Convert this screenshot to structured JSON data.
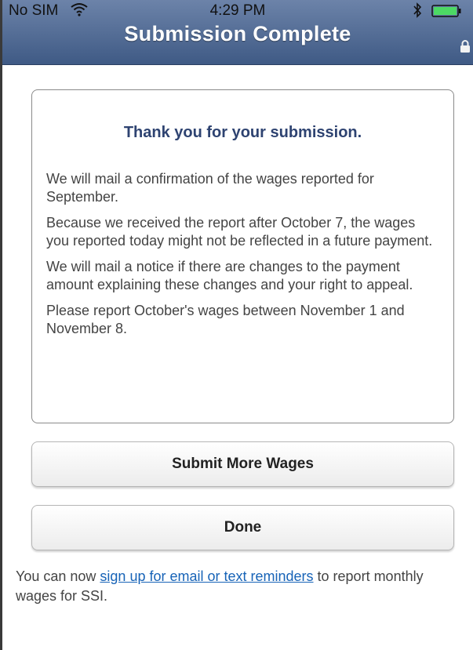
{
  "status_bar": {
    "carrier": "No SIM",
    "time": "4:29 PM",
    "wifi_icon": "wifi-icon",
    "bluetooth_icon": "bluetooth-icon",
    "battery_icon": "battery-icon"
  },
  "header": {
    "title": "Submission Complete",
    "lock_icon": "lock-icon",
    "color": "#4a648f"
  },
  "card": {
    "title": "Thank you for your submission.",
    "paragraphs": [
      "We will mail a confirmation of the wages reported for September.",
      "Because we received the report after October 7, the wages you reported today might not be reflected in a future payment.",
      "We will mail a notice if there are changes to the payment amount explaining these changes and your right to appeal.",
      "Please report October's wages between November 1 and November 8."
    ]
  },
  "buttons": {
    "submit_more": "Submit More Wages",
    "done": "Done"
  },
  "footer": {
    "prefix": "You can now ",
    "link_text": "sign up for email or text reminders",
    "suffix": " to report monthly wages for SSI."
  }
}
